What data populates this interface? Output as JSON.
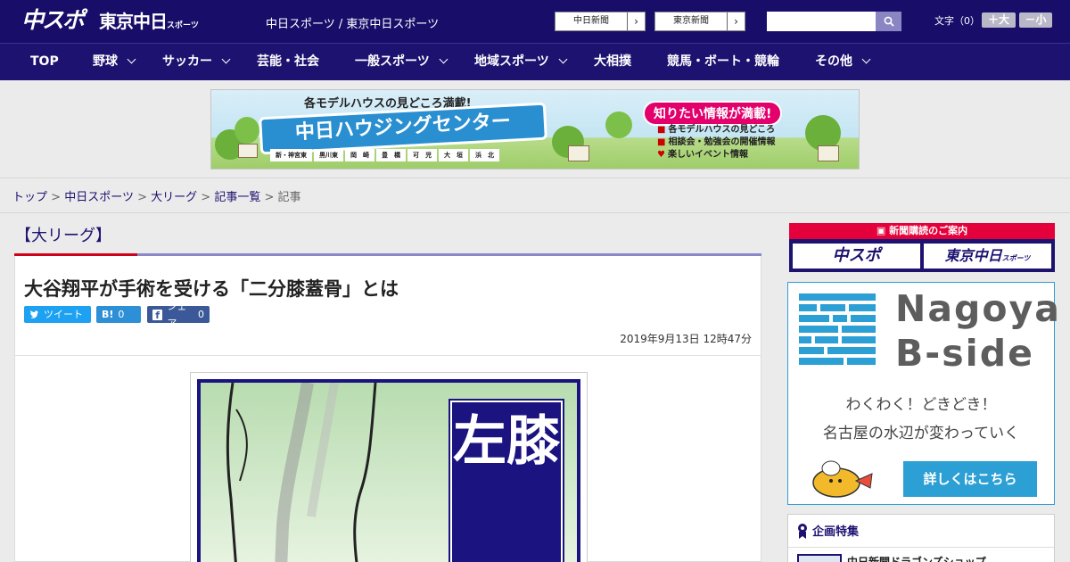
{
  "header": {
    "logo_chuspo": "中スポ",
    "logo_tokyo": "東京中日",
    "logo_tokyo_small": "スポーツ",
    "site_link": "中日スポーツ / 東京中日スポーツ",
    "paper_chunichi": "中日新聞",
    "paper_tokyo": "東京新聞",
    "search_placeholder": "",
    "textsize_label": "文字（0）",
    "textsize_plus": "＋大",
    "textsize_minus": "－小"
  },
  "nav": {
    "items": [
      "TOP",
      "野球",
      "サッカー",
      "芸能・社会",
      "一般スポーツ",
      "地域スポーツ",
      "大相撲",
      "競馬・ボート・競輪",
      "その他"
    ]
  },
  "ad": {
    "subtitle": "各モデルハウスの見どころ満載!",
    "title": "中日ハウジングセンター",
    "cities": [
      "新・神宮東",
      "黒川東",
      "岡　崎",
      "豊　橋",
      "可　児",
      "大　垣",
      "浜　北"
    ],
    "pill": "知りたい情報が満載!",
    "list": [
      "各モデルハウスの見どころ",
      "相談会・勉強会の開催情報",
      "楽しいイベント情報"
    ]
  },
  "breadcrumb": {
    "items": [
      "トップ",
      "中日スポーツ",
      "大リーグ",
      "記事一覧"
    ],
    "current": "記事",
    "separator": ">"
  },
  "category": "【大リーグ】",
  "article": {
    "title": "大谷翔平が手術を受ける「二分膝蓋骨」とは",
    "share_tweet": "ツイート",
    "share_hatena_icon": "B!",
    "share_hatena_count": "0",
    "share_fb_label": "シェア",
    "share_fb_count": "0",
    "date": "2019年9月13日 12時47分",
    "image_label": "左膝"
  },
  "sidebar": {
    "subscription_header": "新聞購読のご案内",
    "sub_chuspo": "中スポ",
    "sub_tokyo": "東京中日",
    "sub_tokyo_small": "スポーツ",
    "nagoya_line1": "Nagoya",
    "nagoya_line2": "B-side",
    "nagoya_text1": "わくわく！どきどき！",
    "nagoya_text2": "名古屋の水辺が変わっていく",
    "nagoya_button": "詳しくはこちら",
    "feature_title": "企画特集",
    "feature_item": "中日新聞ドラゴンズショップ"
  },
  "colors": {
    "brand_navy": "#180e6a",
    "accent_red": "#d0021b",
    "nagoya_blue": "#2c9fd4"
  }
}
